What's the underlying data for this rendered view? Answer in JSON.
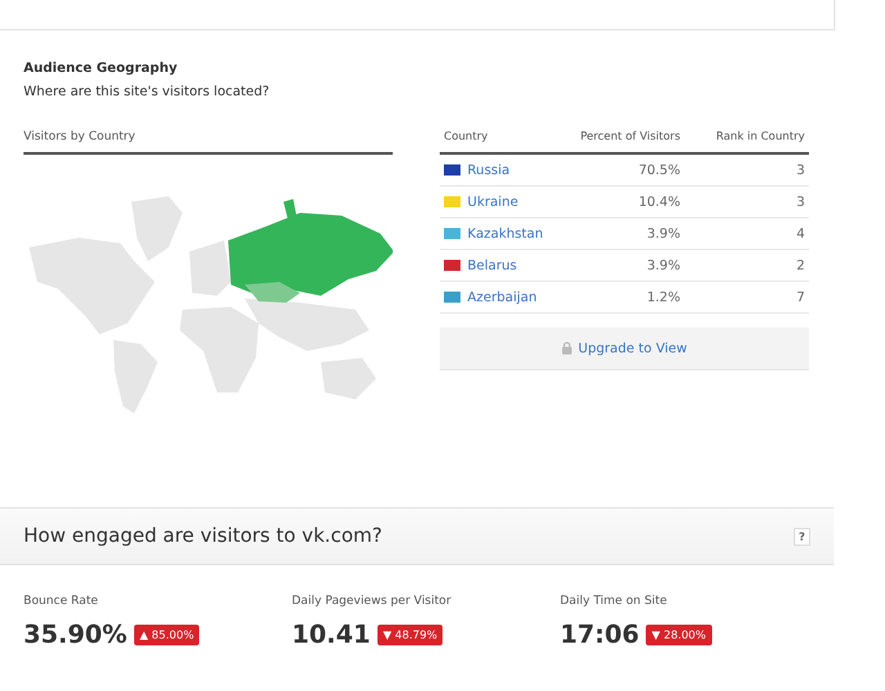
{
  "geography": {
    "title": "Audience Geography",
    "subtitle": "Where are this site's visitors located?",
    "map_title": "Visitors by Country",
    "table": {
      "columns": [
        "Country",
        "Percent of Visitors",
        "Rank in Country"
      ],
      "rows": [
        {
          "country": "Russia",
          "color": "#1c3faa",
          "percent": "70.5%",
          "rank": "3"
        },
        {
          "country": "Ukraine",
          "color": "#f5d51e",
          "percent": "10.4%",
          "rank": "3"
        },
        {
          "country": "Kazakhstan",
          "color": "#49b5d8",
          "percent": "3.9%",
          "rank": "4"
        },
        {
          "country": "Belarus",
          "color": "#d22730",
          "percent": "3.9%",
          "rank": "2"
        },
        {
          "country": "Azerbaijan",
          "color": "#3aa0c8",
          "percent": "1.2%",
          "rank": "7"
        }
      ],
      "upgrade": "Upgrade to View"
    }
  },
  "engagement": {
    "title": "How engaged are visitors to vk.com?",
    "help": "?",
    "metrics": [
      {
        "label": "Bounce Rate",
        "value": "35.90%",
        "arrow": "▲",
        "change": "85.00%"
      },
      {
        "label": "Daily Pageviews per Visitor",
        "value": "10.41",
        "arrow": "▼",
        "change": "48.79%"
      },
      {
        "label": "Daily Time on Site",
        "value": "17:06",
        "arrow": "▼",
        "change": "28.00%"
      }
    ]
  }
}
